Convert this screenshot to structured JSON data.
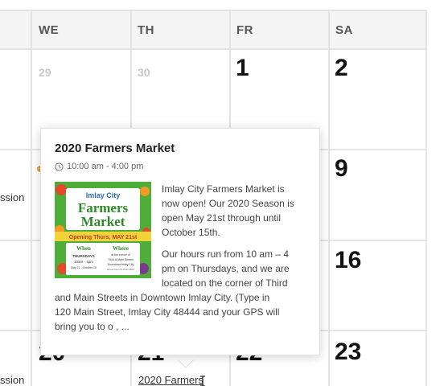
{
  "week_header": [
    "WE",
    "TH",
    "FR",
    "SA"
  ],
  "dates": {
    "we_29": "29",
    "th_30": "30",
    "fr_1": "1",
    "sa_2": "2",
    "sa_9": "9",
    "sa_16": "16",
    "we_20": "20",
    "th_21": "21",
    "fr_22": "22",
    "sa_23": "23"
  },
  "truncated_left": [
    "ssion",
    "ssion"
  ],
  "bottom_event_link": "2020 Farmers",
  "popup": {
    "title": "2020 Farmers Market",
    "time": "10:00 am - 4:00 pm",
    "para1_lines": [
      "Imlay City Farmers Market is",
      "now open! Our 2020 Season is",
      "open May 21st through until",
      "October 15th."
    ],
    "para2_lines": [
      "Our hours run from 10 am – 4",
      "pm on Thursdays, and we are",
      "located on the corner of Third",
      "and Main Streets in Downtown Imlay City. (Type in",
      "120 Main Street, Imlay City 48444 and your GPS will",
      "bring you to o , ..."
    ],
    "image": {
      "town": "Imlay City",
      "brand1": "Farmers",
      "brand2": "Market",
      "opening": "Opening Thurs, MAY 21st",
      "when_label": "When",
      "where_label": "Where",
      "when_day": "THURSDAYS",
      "when_hours": "10am - 4pm",
      "when_dates": "May 21 - October 15",
      "where_line1": "at the corner of",
      "where_line2": "Third & Main Streets",
      "where_line3": "Downtown Imlay City",
      "where_line4": "across from the Post Office"
    }
  },
  "colors": {
    "grid_line": "#e3e3e3",
    "header_bg": "#f4f4f4",
    "muted_date": "#c8c8c8",
    "poster_green": "#4fae3a",
    "poster_banner": "#f0d33a"
  }
}
